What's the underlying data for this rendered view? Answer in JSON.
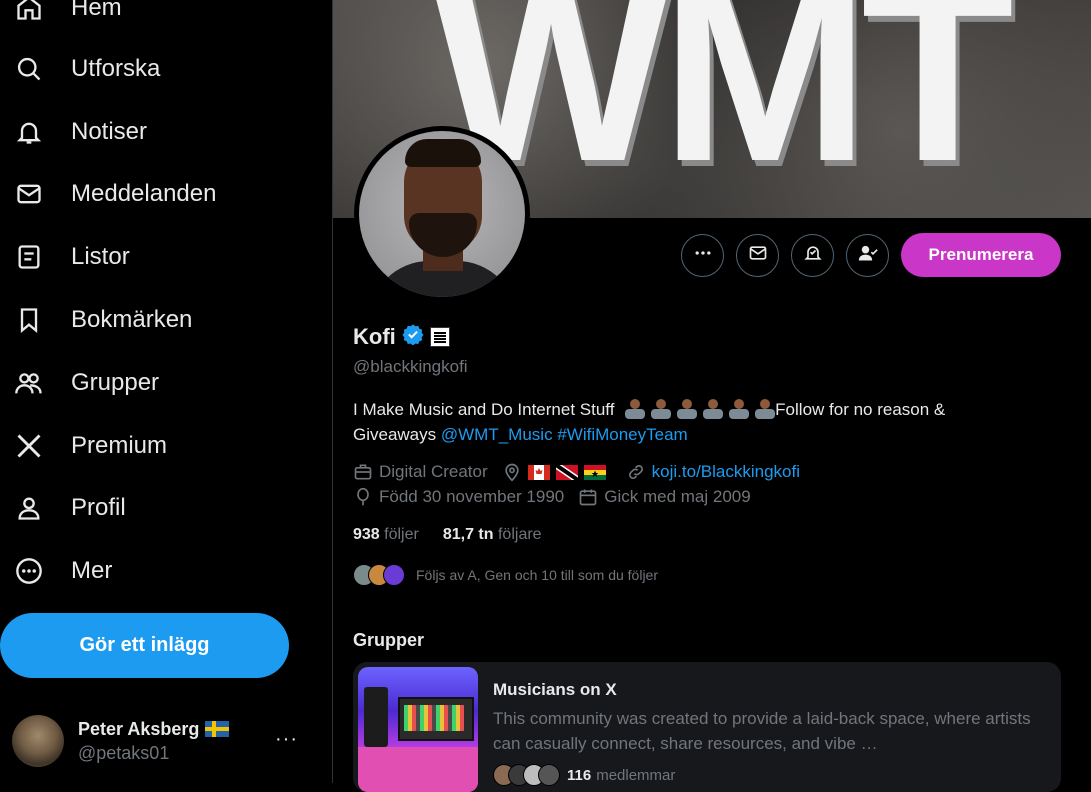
{
  "sidebar": {
    "items": [
      {
        "label": "Hem",
        "icon": "home-icon"
      },
      {
        "label": "Utforska",
        "icon": "search-icon"
      },
      {
        "label": "Notiser",
        "icon": "bell-icon"
      },
      {
        "label": "Meddelanden",
        "icon": "mail-icon"
      },
      {
        "label": "Listor",
        "icon": "list-icon"
      },
      {
        "label": "Bokmärken",
        "icon": "bookmark-icon"
      },
      {
        "label": "Grupper",
        "icon": "people-icon"
      },
      {
        "label": "Premium",
        "icon": "x-logo-icon"
      },
      {
        "label": "Profil",
        "icon": "person-icon"
      },
      {
        "label": "Mer",
        "icon": "more-circle-icon"
      }
    ],
    "post_button": "Gör ett inlägg",
    "account": {
      "name": "Peter Aksberg",
      "handle": "@petaks01",
      "more": "···"
    }
  },
  "banner": {
    "text": "WMT"
  },
  "profile_actions": {
    "subscribe_label": "Prenumerera"
  },
  "profile": {
    "name": "Kofi",
    "handle": "@blackkingkofi",
    "bio_text": "I Make Music and Do Internet Stuff",
    "bio_text_2": "Follow for no reason &",
    "bio_text_3": "Giveaways",
    "bio_link_1": "@WMT_Music",
    "bio_link_2": "#WifiMoneyTeam",
    "category": "Digital Creator",
    "website": "koji.to/Blackkingkofi",
    "birth": "Född 30 november 1990",
    "joined": "Gick med maj 2009",
    "following_count": "938",
    "following_label": "följer",
    "followers_count": "81,7 tn",
    "followers_label": "följare",
    "followed_by": "Följs av A, Gen och 10 till som du följer"
  },
  "groups": {
    "title": "Grupper",
    "items": [
      {
        "name": "Musicians on X",
        "description": "This community was created to provide a laid-back space, where artists can casually connect, share resources, and vibe …",
        "member_count": "116",
        "member_label": "medlemmar"
      }
    ]
  },
  "colors": {
    "accent": "#1d9bf0",
    "subscribe": "#c936c8",
    "muted": "#71767b",
    "text": "#e7e9ea"
  }
}
